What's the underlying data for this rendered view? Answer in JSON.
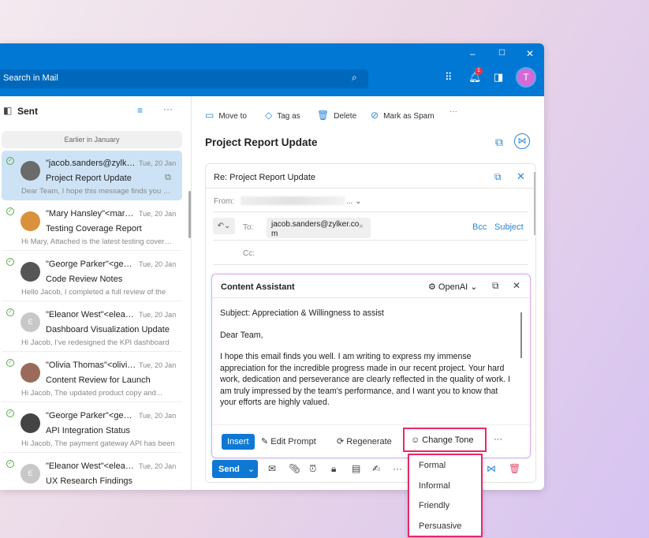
{
  "header": {
    "search_placeholder": "Search in Mail",
    "notification_count": "1",
    "avatar_initial": "T",
    "window_controls": [
      "–",
      "☐",
      "✕"
    ]
  },
  "folder": {
    "title": "Sent",
    "group_label": "Earlier in January"
  },
  "mails": [
    {
      "from": "\"jacob.sanders@zylker.com\"",
      "date": "Tue, 20 Jan",
      "subject": "Project Report Update",
      "preview": "Dear Team, I hope this message finds you well",
      "selected": true,
      "avatar": ""
    },
    {
      "from": "\"Mary Hansley\"<mary.hansley@zylker.com>",
      "date": "Tue, 20 Jan",
      "subject": "Testing Coverage Report",
      "preview": "Hi Mary, Attached is the latest testing coverage",
      "avatar": ""
    },
    {
      "from": "\"George Parker\"<george.parker@zylker.com>",
      "date": "Tue, 20 Jan",
      "subject": "Code Review Notes",
      "preview": "Hello Jacob, I completed a full review of the",
      "avatar": ""
    },
    {
      "from": "\"Eleanor West\"<eleanor.west@zylker.com>",
      "date": "Tue, 20 Jan",
      "subject": "Dashboard Visualization Update",
      "preview": "Hi Jacob, I've redesigned the KPI dashboard",
      "avatar": "E"
    },
    {
      "from": "\"Olivia Thomas\"<olivia.thomas@zylker.com>",
      "date": "Tue, 20 Jan",
      "subject": "Content Review for Launch",
      "preview": "Hi Jacob, The updated product copy and...",
      "avatar": ""
    },
    {
      "from": "\"George Parker\"<george.parker@zylker.com>",
      "date": "Tue, 20 Jan",
      "subject": "API Integration Status",
      "preview": "Hi Jacob, The payment gateway API has been",
      "avatar": ""
    },
    {
      "from": "\"Eleanor West\"<eleanor.west@zylker.com>",
      "date": "Tue, 20 Jan",
      "subject": "UX Research Findings",
      "preview": "",
      "avatar": "E"
    }
  ],
  "toolbar": {
    "move": "Move to",
    "tag": "Tag as",
    "delete": "Delete",
    "spam": "Mark as Spam",
    "more": "···"
  },
  "message": {
    "title": "Project Report Update"
  },
  "compose": {
    "title": "Re: Project Report Update",
    "from_label": "From:",
    "from_suffix": "...",
    "to_label": "To:",
    "to_value": "jacob.sanders@zylker.com",
    "cc_label": "Cc:",
    "bcc": "Bcc",
    "subject_link": "Subject",
    "send": "Send"
  },
  "assistant": {
    "title": "Content Assistant",
    "provider": "OpenAI",
    "subject": "Subject: Appreciation & Willingness to assist",
    "greeting": "Dear Team,",
    "body": "I hope this email finds you well. I am writing to express my immense appreciation for the incredible progress made in our recent project. Your hard work, dedication and perseverance are clearly reflected in the quality of work. I am truly impressed by the team's performance, and I want you to know that your efforts are highly valued.",
    "insert": "Insert",
    "edit": "Edit Prompt",
    "regenerate": "Regenerate",
    "change_tone": "Change Tone",
    "more": "···"
  },
  "tone_menu": [
    "Formal",
    "Informal",
    "Friendly",
    "Persuasive"
  ]
}
